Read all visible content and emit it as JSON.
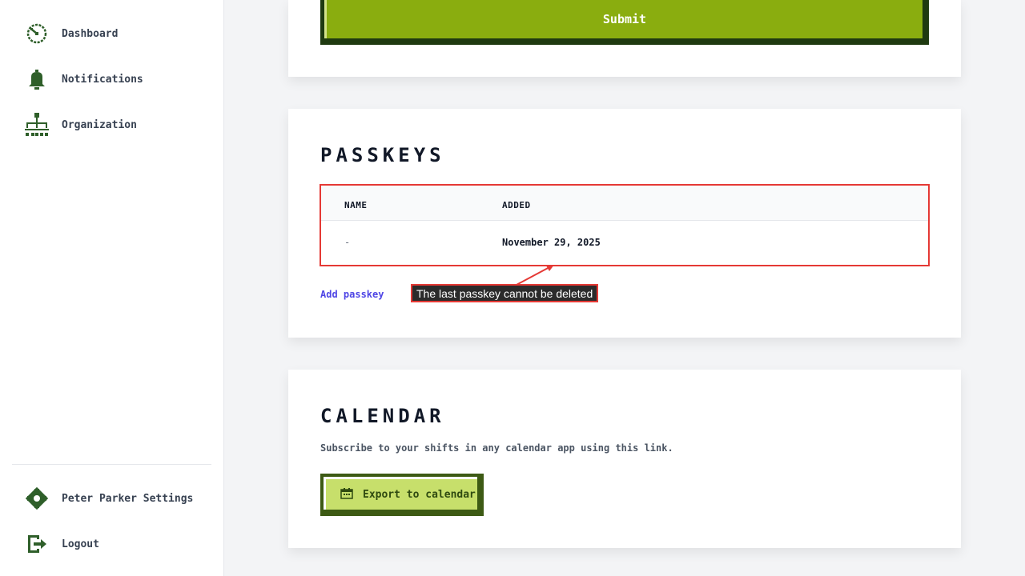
{
  "sidebar": {
    "items": [
      {
        "label": "Dashboard",
        "icon": "dashboard-icon"
      },
      {
        "label": "Notifications",
        "icon": "bell-icon"
      },
      {
        "label": "Organization",
        "icon": "org-chart-icon"
      }
    ],
    "bottom_items": [
      {
        "label": "Peter Parker Settings",
        "icon": "gear-icon"
      },
      {
        "label": "Logout",
        "icon": "logout-icon"
      }
    ]
  },
  "form": {
    "submit_label": "Submit"
  },
  "passkeys": {
    "title": "PASSKEYS",
    "columns": [
      "NAME",
      "ADDED"
    ],
    "rows": [
      {
        "name": "-",
        "added": "November 29, 2025"
      }
    ],
    "add_label": "Add passkey",
    "tooltip": "The last passkey cannot be deleted"
  },
  "calendar": {
    "title": "CALENDAR",
    "description": "Subscribe to your shifts in any calendar app using this link.",
    "export_label": "Export to calendar"
  },
  "colors": {
    "primary_green": "#8aad0f",
    "dark_green": "#1f3a10",
    "icon_green": "#2f5f2a",
    "link_purple": "#4f46e5",
    "highlight_red": "#e53935"
  }
}
